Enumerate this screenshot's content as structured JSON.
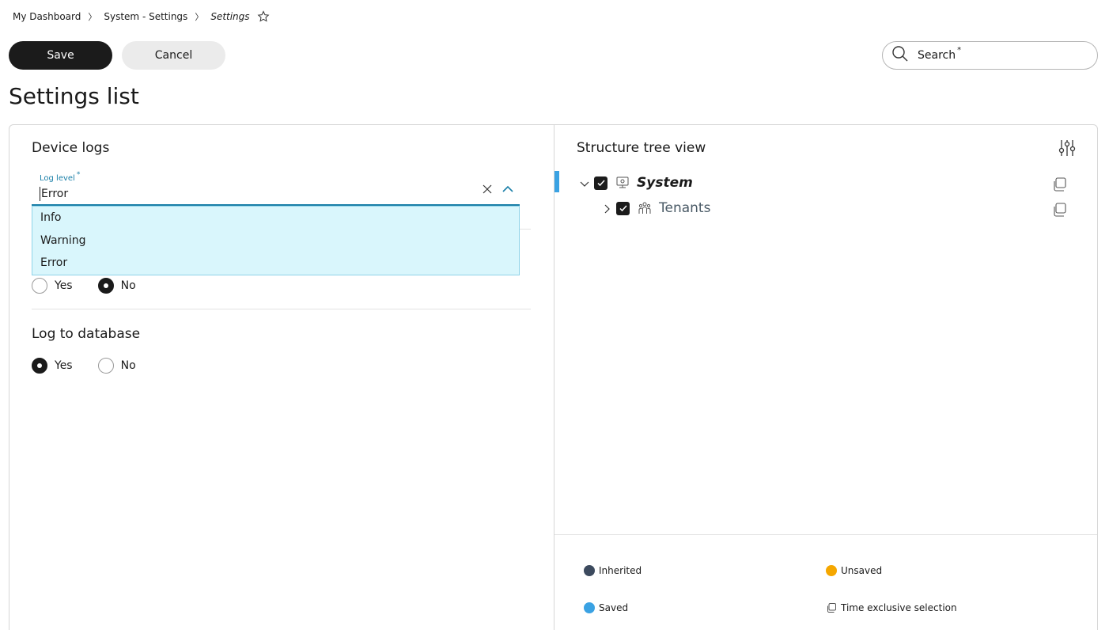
{
  "breadcrumb": {
    "items": [
      "My Dashboard",
      "System - Settings",
      "Settings"
    ],
    "separator": "〉"
  },
  "toolbar": {
    "save_label": "Save",
    "cancel_label": "Cancel"
  },
  "search": {
    "label": "Search",
    "required_mark": "*"
  },
  "page_title": "Settings list",
  "device_logs": {
    "title": "Device logs",
    "log_level": {
      "label": "Log level",
      "required_mark": "*",
      "value": "Error",
      "options": [
        "Info",
        "Warning",
        "Error"
      ]
    },
    "hidden_setting": {
      "options": [
        "Yes",
        "No"
      ],
      "selected": "No"
    },
    "log_to_database": {
      "title": "Log to database",
      "options": [
        "Yes",
        "No"
      ],
      "selected": "Yes"
    }
  },
  "tree": {
    "title": "Structure tree view",
    "nodes": [
      {
        "label": "System",
        "expanded": true,
        "checked": true,
        "icon": "monitor-icon"
      },
      {
        "label": "Tenants",
        "expanded": false,
        "checked": true,
        "icon": "people-icon"
      }
    ]
  },
  "legend": {
    "inherited": "Inherited",
    "unsaved": "Unsaved",
    "saved": "Saved",
    "time_exclusive": "Time exclusive selection"
  },
  "colors": {
    "inherited": "#3c4a5e",
    "unsaved": "#f5a700",
    "saved": "#3aa2e3",
    "accent": "#1a7fa8",
    "dropdown_bg": "#d9f6fc"
  }
}
